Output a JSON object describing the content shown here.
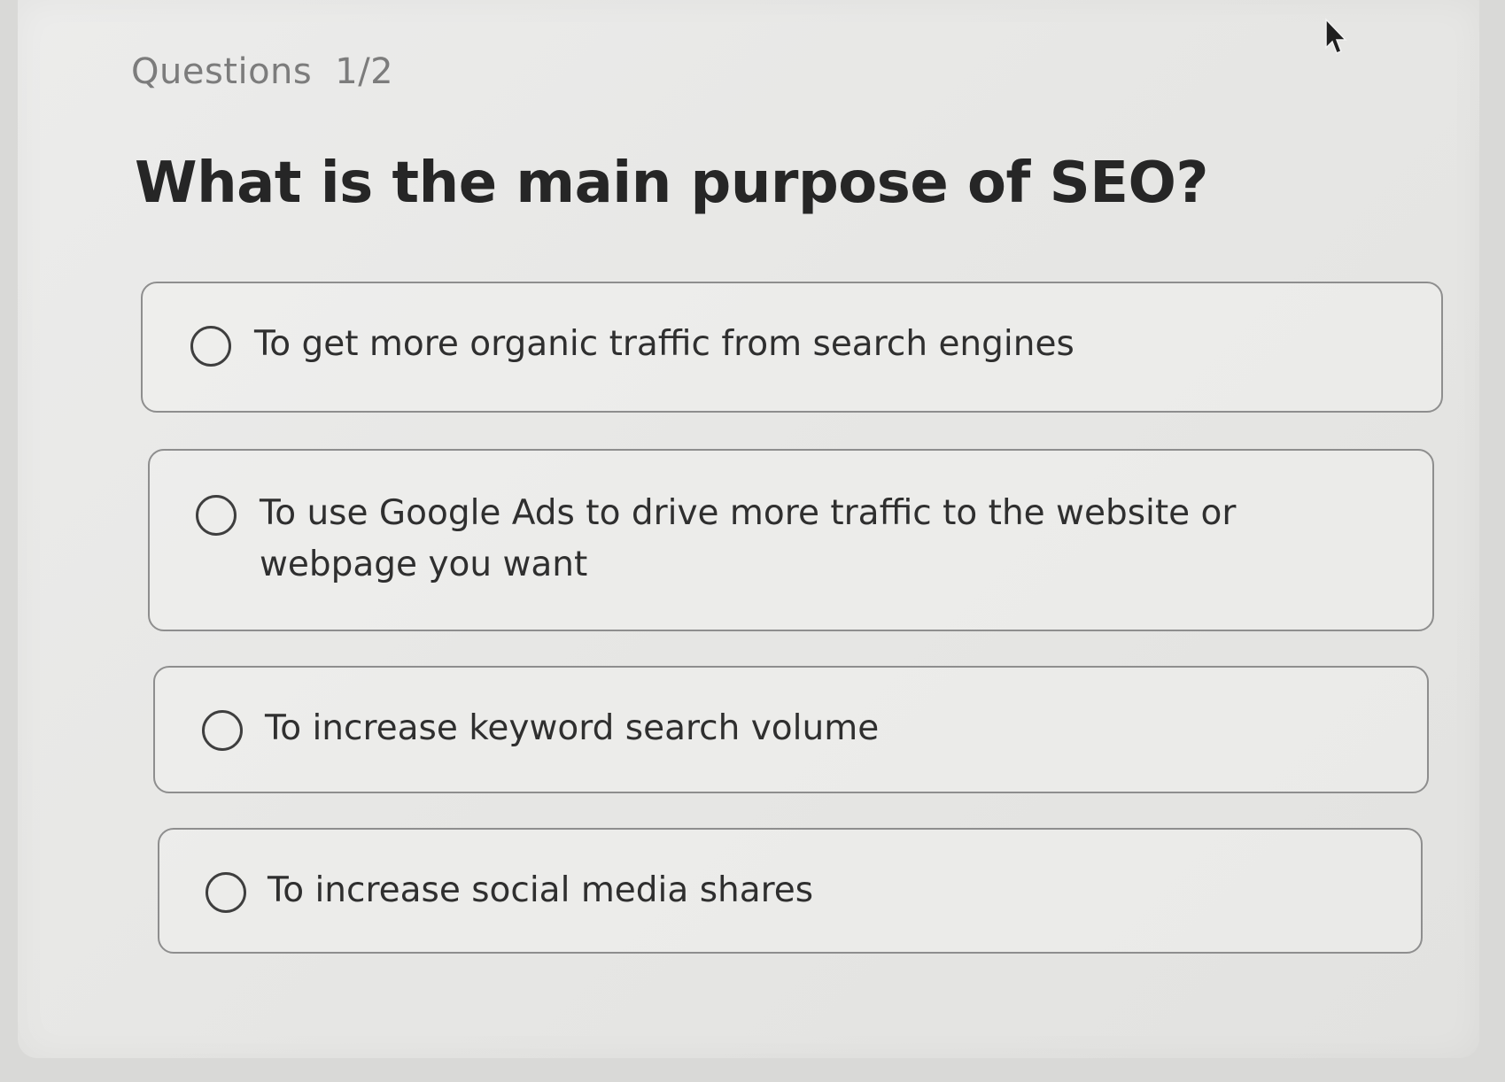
{
  "header": {
    "section_label": "Questions",
    "progress": "1/2"
  },
  "question": {
    "text": "What is the main purpose of SEO?"
  },
  "options": [
    {
      "label": "To get more organic traffic from search engines",
      "selected": false
    },
    {
      "label": "To use Google Ads to drive more traffic to the website or webpage you want",
      "selected": false
    },
    {
      "label": "To increase keyword search volume",
      "selected": false
    },
    {
      "label": "To increase social media shares",
      "selected": false
    }
  ],
  "icons": {
    "cursor": "mouse-pointer-icon",
    "radio": "radio-unchecked-icon"
  },
  "colors": {
    "background": "#e7e7e5",
    "text": "#2f2f2f",
    "muted_text": "#7c7c7c",
    "border": "#8e8e8e"
  }
}
